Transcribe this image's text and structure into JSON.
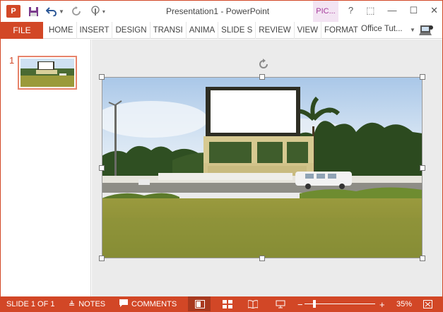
{
  "app": {
    "title": "Presentation1 - PowerPoint",
    "picture_tools_tab": "PIC...",
    "brand_color": "#d24726"
  },
  "quick_access": {
    "logo_text": "P",
    "icons": [
      "save-icon",
      "undo-icon",
      "redo-icon",
      "touch-mode-icon",
      "customize-icon"
    ]
  },
  "window_controls": {
    "help": "?",
    "ribbon_display": "⬚",
    "minimize": "—",
    "maximize": "☐",
    "close": "✕"
  },
  "ribbon": {
    "file_label": "FILE",
    "tabs": [
      "HOME",
      "INSERT",
      "DESIGN",
      "TRANSI",
      "ANIMA",
      "SLIDE S",
      "REVIEW",
      "VIEW",
      "FORMAT"
    ],
    "account": "Office Tut..."
  },
  "thumbnails": {
    "slides": [
      {
        "number": "1"
      }
    ]
  },
  "status": {
    "slide_info": "SLIDE 1 OF 1",
    "notes": "NOTES",
    "comments": "COMMENTS",
    "zoom_minus": "−",
    "zoom_plus": "+",
    "zoom": "35%",
    "zoom_level": 0.35
  }
}
